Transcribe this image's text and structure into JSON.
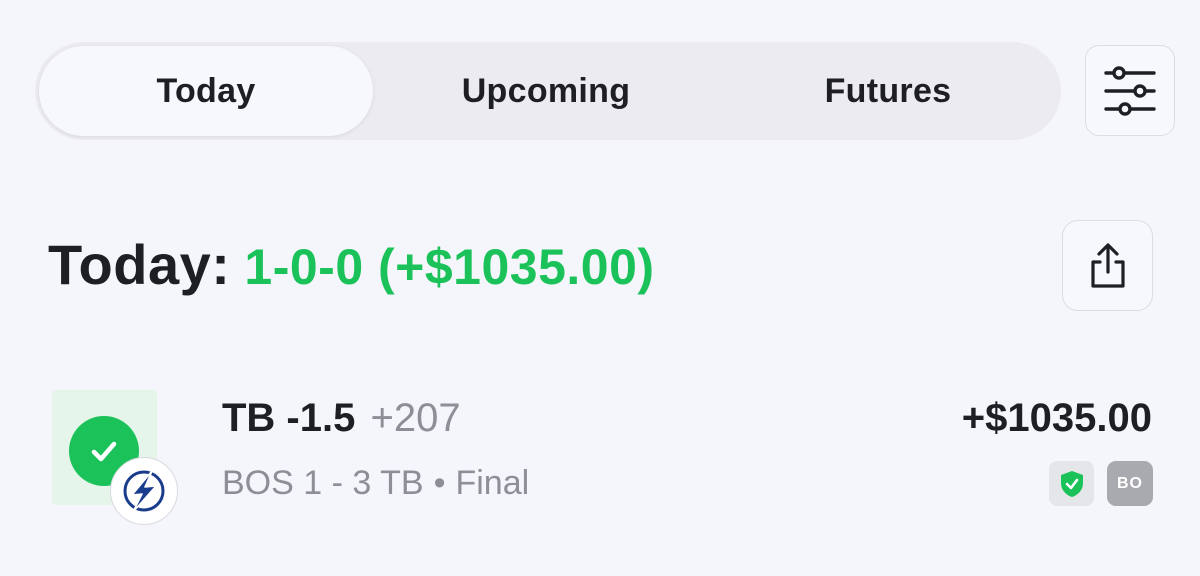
{
  "tabs": [
    {
      "label": "Today",
      "active": true
    },
    {
      "label": "Upcoming",
      "active": false
    },
    {
      "label": "Futures",
      "active": false
    }
  ],
  "summary": {
    "label": "Today:",
    "record": "1-0-0 (+$1035.00)"
  },
  "bets": [
    {
      "pick": "TB -1.5",
      "odds": "+207",
      "score": "BOS 1 - 3 TB",
      "separator": "•",
      "status": "Final",
      "payout": "+$1035.00",
      "sportsbook": "BO",
      "result": "win",
      "team_logo": "tampa-bay-lightning-logo"
    }
  ],
  "colors": {
    "background": "#f5f6fb",
    "win_green": "#1bc25a",
    "tile_green": "#e5f5ea",
    "muted_text": "#8e8f96",
    "primary_text": "#1e1f24",
    "lightning_blue": "#1a3c8c"
  },
  "icons": {
    "filter": "sliders-icon",
    "share": "share-icon",
    "result": "checkmark-icon",
    "insured": "shield-check-icon"
  }
}
